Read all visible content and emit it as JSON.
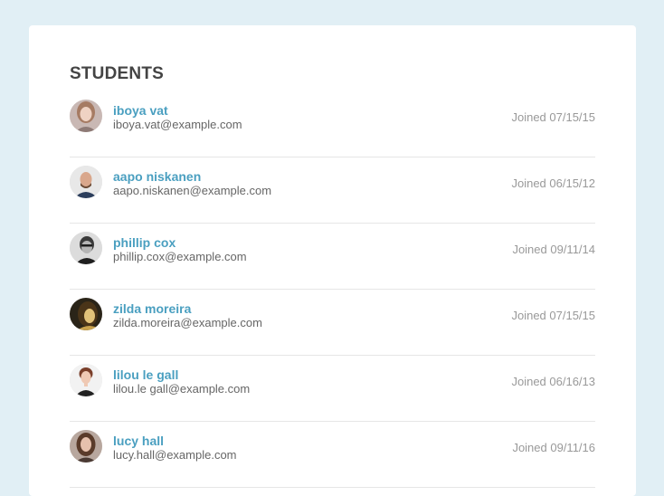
{
  "page": {
    "title": "STUDENTS",
    "colors": {
      "background": "#e1eff5",
      "card": "#ffffff",
      "name_link": "#4a9fc0",
      "email_text": "#666666",
      "joined_text": "#999999",
      "divider": "#e6e6e6"
    }
  },
  "students": [
    {
      "name": "iboya vat",
      "email": "iboya.vat@example.com",
      "joined": "Joined 07/15/15",
      "avatar": "photo-avatar-icon"
    },
    {
      "name": "aapo niskanen",
      "email": "aapo.niskanen@example.com",
      "joined": "Joined 06/15/12",
      "avatar": "photo-avatar-icon"
    },
    {
      "name": "phillip cox",
      "email": "phillip.cox@example.com",
      "joined": "Joined 09/11/14",
      "avatar": "photo-avatar-icon"
    },
    {
      "name": "zilda moreira",
      "email": "zilda.moreira@example.com",
      "joined": "Joined 07/15/15",
      "avatar": "photo-avatar-icon"
    },
    {
      "name": "lilou le gall",
      "email": "lilou.le gall@example.com",
      "joined": "Joined 06/16/13",
      "avatar": "photo-avatar-icon"
    },
    {
      "name": "lucy hall",
      "email": "lucy.hall@example.com",
      "joined": "Joined 09/11/16",
      "avatar": "photo-avatar-icon"
    }
  ]
}
